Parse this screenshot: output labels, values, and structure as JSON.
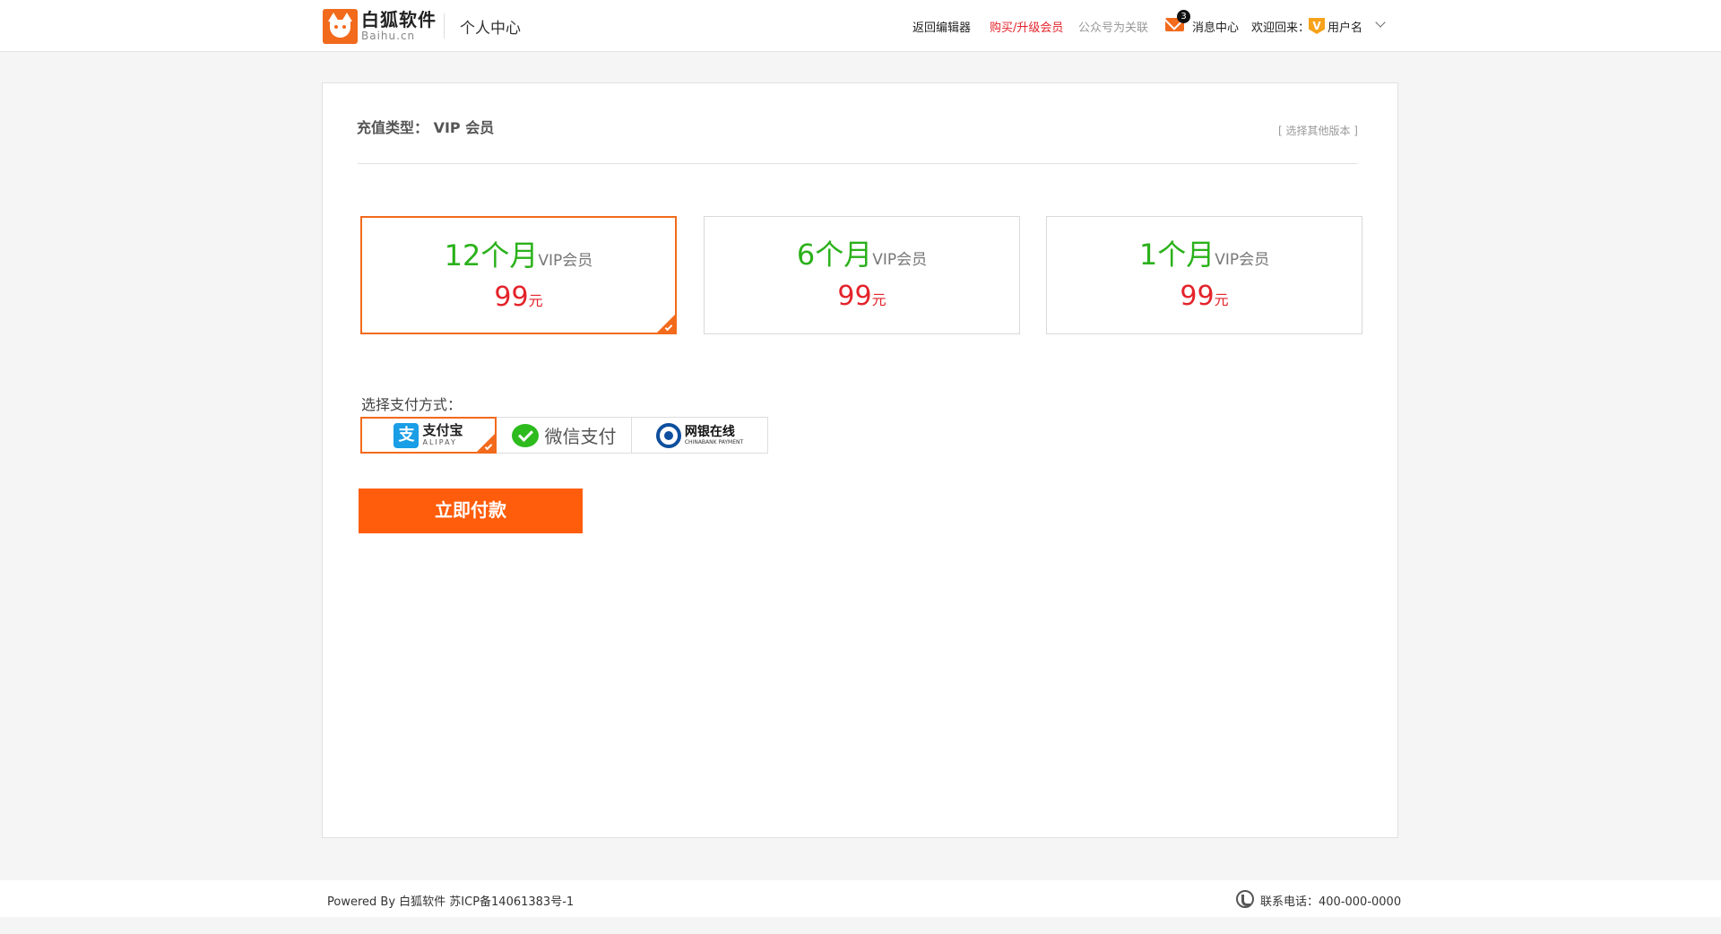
{
  "header": {
    "logo_name": "白狐软件",
    "logo_domain": "Baihu.cn",
    "page_title": "个人中心",
    "nav": {
      "editor": "返回编辑器",
      "buy": "购买/升级会员",
      "wechat": "公众号为关联",
      "message_count": "3",
      "messages": "消息中心",
      "welcome": "欢迎回来：",
      "vip_badge": "V",
      "username": "用户名"
    },
    "icons": [
      "logo-fox-icon",
      "mail-icon",
      "vip-icon",
      "chevron-down-icon"
    ]
  },
  "main": {
    "type_label": "充值类型：  VIP 会员",
    "other_version": "[ 选择其他版本 ]",
    "plans": [
      {
        "months": "12个月",
        "vip": "VIP会员",
        "price": "99",
        "unit": "元",
        "selected": true
      },
      {
        "months": "6个月",
        "vip": "VIP会员",
        "price": "99",
        "unit": "元",
        "selected": false
      },
      {
        "months": "1个月",
        "vip": "VIP会员",
        "price": "99",
        "unit": "元",
        "selected": false
      }
    ],
    "payment": {
      "label": "选择支付方式：",
      "alipay": {
        "icon_text": "支",
        "name": "支付宝",
        "sub": "ALIPAY",
        "selected": true
      },
      "wechat": {
        "name": "微信支付",
        "selected": false
      },
      "bank": {
        "name": "网银在线",
        "sub": "CHINABANK PAYMENT",
        "selected": false
      }
    },
    "pay_button": "立即付款"
  },
  "footer": {
    "powered": "Powered By 白狐软件 苏ICP备14061383号-1",
    "phone": "联系电话：400-000-0000"
  },
  "colors": {
    "accent": "#f26a1b",
    "button": "#ff5d0c",
    "green": "#2bb11b",
    "price_red": "#e4232b"
  }
}
